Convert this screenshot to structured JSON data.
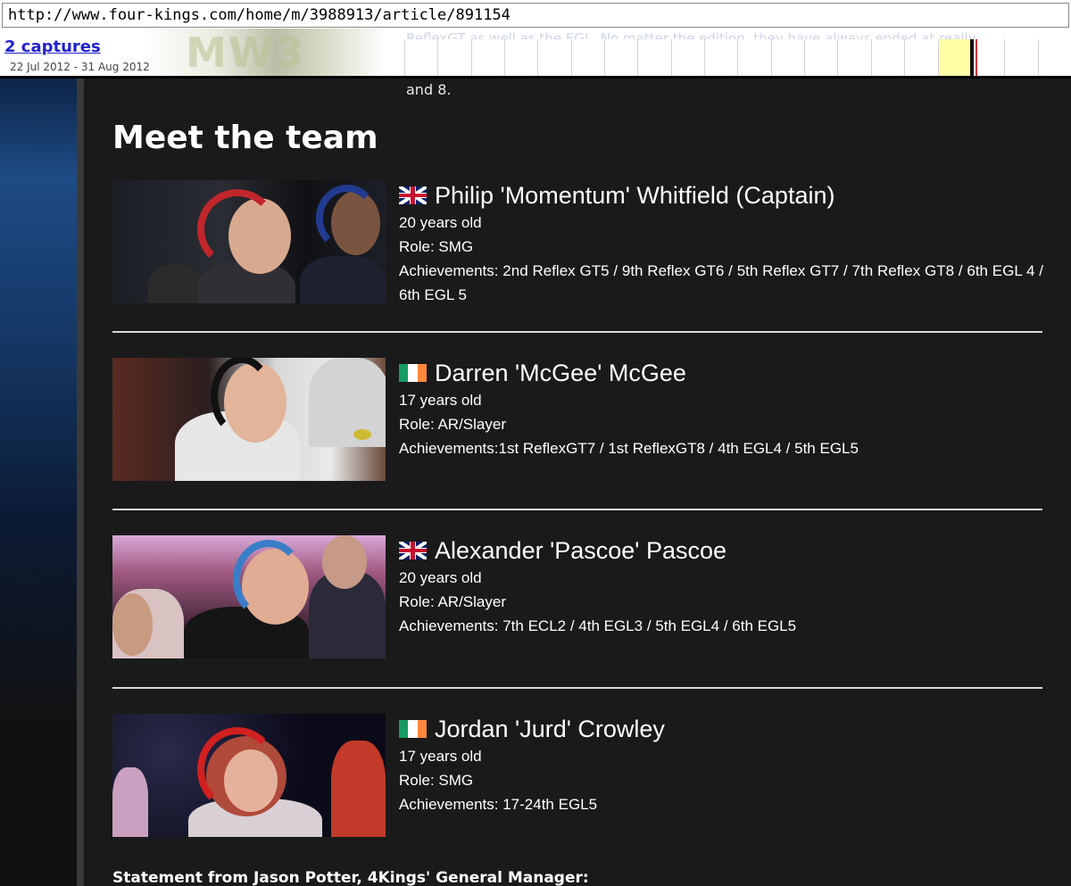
{
  "wayback": {
    "url": "http://www.four-kings.com/home/m/3988913/article/891154",
    "captures_label": "2 captures",
    "date_range": "22 Jul 2012 - 31 Aug 2012",
    "banner_text": "MW3",
    "ghost_text": "ReflexGT as well as the EGL. No matter the edition, they have always ended at really"
  },
  "article": {
    "fragment_text": "and 8.",
    "section_title": "Meet the team",
    "statement_label": "Statement from Jason Potter, 4Kings' General Manager:"
  },
  "members": [
    {
      "flag_icon": "uk-flag-icon",
      "name": "Philip 'Momentum' Whitfield (Captain)",
      "age": "20 years old",
      "role": "Role: SMG",
      "achievements": "Achievements: 2nd Reflex GT5 / 9th Reflex GT6 / 5th Reflex GT7 / 7th Reflex GT8 / 6th EGL 4  / 6th EGL 5"
    },
    {
      "flag_icon": "ireland-flag-icon",
      "name": "Darren 'McGee' McGee",
      "age": "17 years old",
      "role": "Role: AR/Slayer",
      "achievements": "Achievements:1st ReflexGT7 / 1st ReflexGT8 / 4th EGL4 / 5th EGL5"
    },
    {
      "flag_icon": "uk-flag-icon",
      "name": "Alexander 'Pascoe' Pascoe",
      "age": "20 years old",
      "role": "Role: AR/Slayer",
      "achievements": "Achievements: 7th ECL2 / 4th EGL3 / 5th EGL4 / 6th EGL5"
    },
    {
      "flag_icon": "ireland-flag-icon",
      "name": "Jordan 'Jurd' Crowley",
      "age": "17 years old",
      "role": "Role: SMG",
      "achievements": "Achievements: 17-24th EGL5"
    }
  ],
  "colors": {
    "page_bg": "#1a1a1a",
    "link_blue": "#2222cc",
    "divider": "#d8d8d8"
  }
}
